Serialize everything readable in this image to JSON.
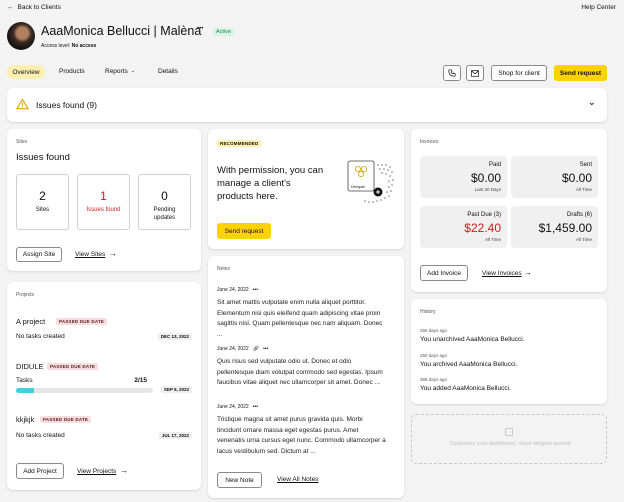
{
  "topbar": {
    "back": "Back to Clients",
    "help": "Help Center"
  },
  "client": {
    "name": "AaaMonica Bellucci | Malèna",
    "more": "•••",
    "status": "Active",
    "access_label": "Access level:",
    "access_value": "No access"
  },
  "tabs": [
    {
      "label": "Overview"
    },
    {
      "label": "Products"
    },
    {
      "label": "Reports"
    },
    {
      "label": "Details"
    }
  ],
  "actions": {
    "shop": "Shop for client",
    "send": "Send request"
  },
  "issues_bar": {
    "label": "Issues found",
    "count": "(9)"
  },
  "sites": {
    "section": "Sites",
    "heading": "Issues found",
    "stats": [
      {
        "value": "2",
        "label": "Sites"
      },
      {
        "value": "1",
        "label": "Issues found"
      },
      {
        "value": "0",
        "label": "Pending updates"
      }
    ],
    "assign": "Assign Site",
    "view": "View Sites"
  },
  "recommended": {
    "tag": "RECOMMENDED",
    "text": "With permission, you can manage a client's products here.",
    "illustration_label": "Delegate",
    "button": "Send request"
  },
  "invoices": {
    "section": "Invoices",
    "tiles": [
      {
        "label": "Paid",
        "value": "$0.00",
        "sub": "Last 30 Days"
      },
      {
        "label": "Sent",
        "value": "$0.00",
        "sub": "All Time"
      },
      {
        "label": "Past Due (3)",
        "value": "$22.40",
        "sub": "All Time"
      },
      {
        "label": "Drafts (6)",
        "value": "$1,459.00",
        "sub": "All Time"
      }
    ],
    "add": "Add Invoice",
    "view": "View Invoices"
  },
  "projects": {
    "section": "Projects",
    "items": [
      {
        "name": "A project",
        "tag": "PASSED DUE DATE",
        "status": "No tasks created",
        "date": "DEC 13, 2022"
      },
      {
        "name": "DIDULE",
        "tag": "PASSED DUE DATE",
        "status": "Tasks",
        "progress_text": "2/15",
        "progress": 0.1333,
        "date": "SEP 9, 2022"
      },
      {
        "name": "kkjkjk",
        "tag": "PASSED DUE DATE",
        "status": "No tasks created",
        "date": "JUL 17, 2022"
      }
    ],
    "add": "Add Project",
    "view": "View Projects"
  },
  "notes": {
    "section": "Notes",
    "items": [
      {
        "date": "June 24, 2022",
        "more": "•••",
        "text": "Sit amet mattis vulputate enim nulla aliquet porttitor. Elementum nisi quis eleifend quam adipiscing vitae proin sagittis nisl. Quam pellentesque nec nam aliquam. Donec ..."
      },
      {
        "date": "June 24, 2022",
        "more": "•••",
        "text": "Quis risus sed vulputate odio ut. Donec et odio pellentesque diam volutpat commodo sed egestas. Ipsum faucibus vitae aliquet nec ullamcorper sit amet. Donec ..."
      },
      {
        "date": "June 24, 2022",
        "more": "•••",
        "text": "Tristique magna sit amet purus gravida quis. Morbi tincidunt ornare massa eget egestas purus. Amet venenatis urna cursus eget nunc. Commodo ullamcorper a lacus vestibulum sed. Dictum at ..."
      }
    ],
    "new": "New Note",
    "view": "View All Notes"
  },
  "history": {
    "section": "History",
    "items": [
      {
        "time": "250 days ago",
        "text": "You unarchived AaaMonica Bellucci."
      },
      {
        "time": "250 days ago",
        "text": "You archived AaaMonica Bellucci."
      },
      {
        "time": "368 days ago",
        "text": "You added AaaMonica Bellucci."
      }
    ]
  },
  "customize": {
    "text": "Customize your dashboard, move widgets around"
  },
  "colors": {
    "accent": "#ffd200",
    "danger": "#d11a1a",
    "active": "#1e8a4c",
    "progress": "#3fd0d8"
  }
}
